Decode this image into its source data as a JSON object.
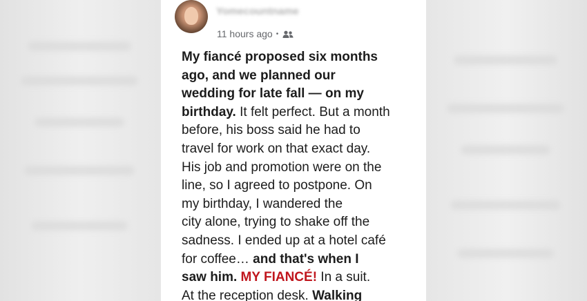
{
  "post": {
    "author_name": "Yomecountname",
    "timestamp": "11 hours ago",
    "separator": "•",
    "audience_icon": "friends-icon",
    "lines": [
      [
        {
          "t": "My fiancé proposed six months",
          "s": "b"
        }
      ],
      [
        {
          "t": "ago, and we planned our",
          "s": "b"
        }
      ],
      [
        {
          "t": "wedding for late fall — on my",
          "s": "b"
        }
      ],
      [
        {
          "t": "birthday.",
          "s": "b"
        },
        {
          "t": " It felt perfect. But a month",
          "s": ""
        }
      ],
      [
        {
          "t": "before, his boss said he had to",
          "s": ""
        }
      ],
      [
        {
          "t": "travel for work on that exact day.",
          "s": ""
        }
      ],
      [
        {
          "t": "His job and promotion were on the",
          "s": ""
        }
      ],
      [
        {
          "t": "line, so I agreed to postpone. On",
          "s": ""
        }
      ],
      [
        {
          "t": "my birthday, I wandered the",
          "s": ""
        }
      ],
      [
        {
          "t": "city alone, trying to shake off the",
          "s": ""
        }
      ],
      [
        {
          "t": "sadness. I ended up at a hotel café",
          "s": ""
        }
      ],
      [
        {
          "t": "for coffee… ",
          "s": ""
        },
        {
          "t": "and that's when I",
          "s": "b"
        }
      ],
      [
        {
          "t": "saw him. ",
          "s": "b"
        },
        {
          "t": "MY FIANCÉ!",
          "s": "red"
        },
        {
          "t": " In a suit.",
          "s": ""
        }
      ],
      [
        {
          "t": "At the reception desk. ",
          "s": ""
        },
        {
          "t": "Walking",
          "s": "b"
        }
      ]
    ]
  },
  "colors": {
    "accent_red": "#c0161d",
    "text": "#1c1c1c",
    "meta": "#65676b",
    "background_blur": "#e9e9e9"
  }
}
